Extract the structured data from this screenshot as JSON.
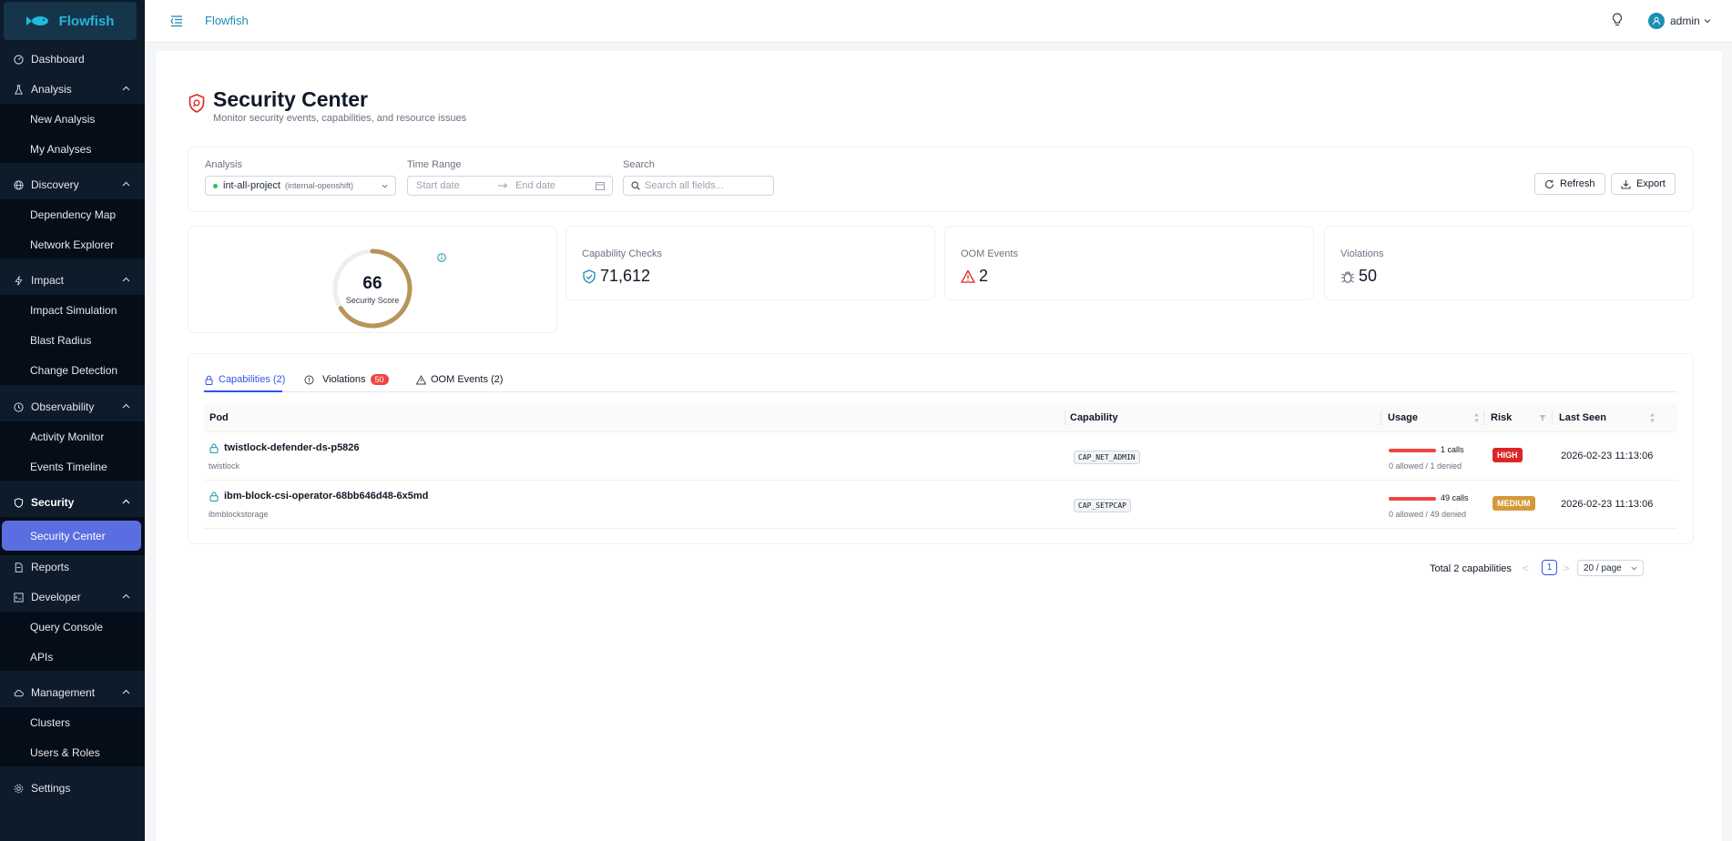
{
  "brand": {
    "logo_text": "Flowfish",
    "topbar_title": "Flowfish"
  },
  "user": {
    "name": "admin"
  },
  "sidebar": {
    "dashboard": "Dashboard",
    "analysis": "Analysis",
    "new_analysis": "New Analysis",
    "my_analyses": "My Analyses",
    "discovery": "Discovery",
    "dependency_map": "Dependency Map",
    "network_explorer": "Network Explorer",
    "impact": "Impact",
    "impact_simulation": "Impact Simulation",
    "blast_radius": "Blast Radius",
    "change_detection": "Change Detection",
    "observability": "Observability",
    "activity_monitor": "Activity Monitor",
    "events_timeline": "Events Timeline",
    "security": "Security",
    "security_center": "Security Center",
    "reports": "Reports",
    "developer": "Developer",
    "query_console": "Query Console",
    "apis": "APIs",
    "management": "Management",
    "clusters": "Clusters",
    "users_roles": "Users & Roles",
    "settings": "Settings"
  },
  "page": {
    "title": "Security Center",
    "subtitle": "Monitor security events, capabilities, and resource issues"
  },
  "filters": {
    "analysis_label": "Analysis",
    "analysis_value": "int-all-project",
    "analysis_scope": "(internal-openshift)",
    "time_label": "Time Range",
    "start_placeholder": "Start date",
    "end_placeholder": "End date",
    "search_label": "Search",
    "search_placeholder": "Search all fields...",
    "refresh": "Refresh",
    "export": "Export"
  },
  "stats": {
    "score": {
      "value": 66,
      "percent": 66,
      "label": "Security Score"
    },
    "capability_checks": {
      "label": "Capability Checks",
      "value": "71,612"
    },
    "oom_events": {
      "label": "OOM Events",
      "value": "2"
    },
    "violations": {
      "label": "Violations",
      "value": "50"
    }
  },
  "tabs": {
    "capabilities": "Capabilities (2)",
    "violations": "Violations",
    "violations_badge": "50",
    "oom": "OOM Events (2)"
  },
  "table": {
    "headers": {
      "pod": "Pod",
      "capability": "Capability",
      "usage": "Usage",
      "risk": "Risk",
      "last_seen": "Last Seen"
    },
    "rows": [
      {
        "pod": "twistlock-defender-ds-p5826",
        "namespace": "twistlock",
        "capability": "CAP_NET_ADMIN",
        "calls": "1 calls",
        "detail": "0 allowed / 1 denied",
        "risk": "HIGH",
        "last_seen": "2026-02-23 11:13:06"
      },
      {
        "pod": "ibm-block-csi-operator-68bb646d48-6x5md",
        "namespace": "ibmblockstorage",
        "capability": "CAP_SETPCAP",
        "calls": "49 calls",
        "detail": "0 allowed / 49 denied",
        "risk": "MEDIUM",
        "last_seen": "2026-02-23 11:13:06"
      }
    ]
  },
  "pagination": {
    "total": "Total 2 capabilities",
    "prev": "<",
    "page": "1",
    "next": ">",
    "page_size": "20 / page"
  },
  "colors": {
    "sidebar_bg": "#0d1b2a",
    "accent": "#5b6ee1",
    "brand": "#22b8d8",
    "score_ring": "#b8945a",
    "danger": "#dc2626",
    "warning": "#d49a3a",
    "link": "#2f54eb"
  }
}
